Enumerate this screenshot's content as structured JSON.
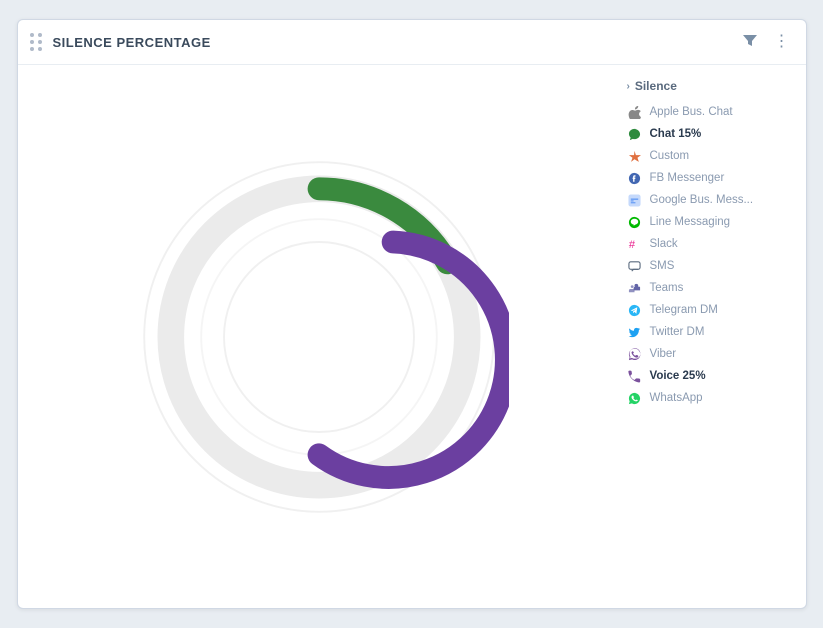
{
  "header": {
    "title": "SILENCE PERCENTAGE",
    "filter_icon": "▼",
    "more_icon": "⋮"
  },
  "legend": {
    "header_label": "Silence",
    "items": [
      {
        "id": "apple-bus-chat",
        "label": "Apple Bus. Chat",
        "icon_type": "apple",
        "bold": false,
        "muted": true
      },
      {
        "id": "chat",
        "label": "Chat 15%",
        "icon_type": "chat",
        "bold": true,
        "muted": false
      },
      {
        "id": "custom",
        "label": "Custom",
        "icon_type": "custom",
        "bold": false,
        "muted": true
      },
      {
        "id": "fb-messenger",
        "label": "FB Messenger",
        "icon_type": "fb",
        "bold": false,
        "muted": true
      },
      {
        "id": "google-bus-mess",
        "label": "Google Bus. Mess...",
        "icon_type": "google",
        "bold": false,
        "muted": true
      },
      {
        "id": "line-messaging",
        "label": "Line Messaging",
        "icon_type": "line",
        "bold": false,
        "muted": true
      },
      {
        "id": "slack",
        "label": "Slack",
        "icon_type": "slack",
        "bold": false,
        "muted": true
      },
      {
        "id": "sms",
        "label": "SMS",
        "icon_type": "sms",
        "bold": false,
        "muted": true
      },
      {
        "id": "teams",
        "label": "Teams",
        "icon_type": "teams",
        "bold": false,
        "muted": true
      },
      {
        "id": "telegram-dm",
        "label": "Telegram DM",
        "icon_type": "telegram",
        "bold": false,
        "muted": true
      },
      {
        "id": "twitter-dm",
        "label": "Twitter DM",
        "icon_type": "twitter",
        "bold": false,
        "muted": true
      },
      {
        "id": "viber",
        "label": "Viber",
        "icon_type": "viber",
        "bold": false,
        "muted": true
      },
      {
        "id": "voice",
        "label": "Voice 25%",
        "icon_type": "voice",
        "bold": true,
        "muted": false
      },
      {
        "id": "whatsapp",
        "label": "WhatsApp",
        "icon_type": "whatsapp",
        "bold": false,
        "muted": true
      }
    ]
  },
  "chart": {
    "green_color": "#3a8a3e",
    "purple_color": "#6b3fa0",
    "bg_ring_color": "#ebebeb",
    "chat_percent": 15,
    "voice_percent": 25
  }
}
